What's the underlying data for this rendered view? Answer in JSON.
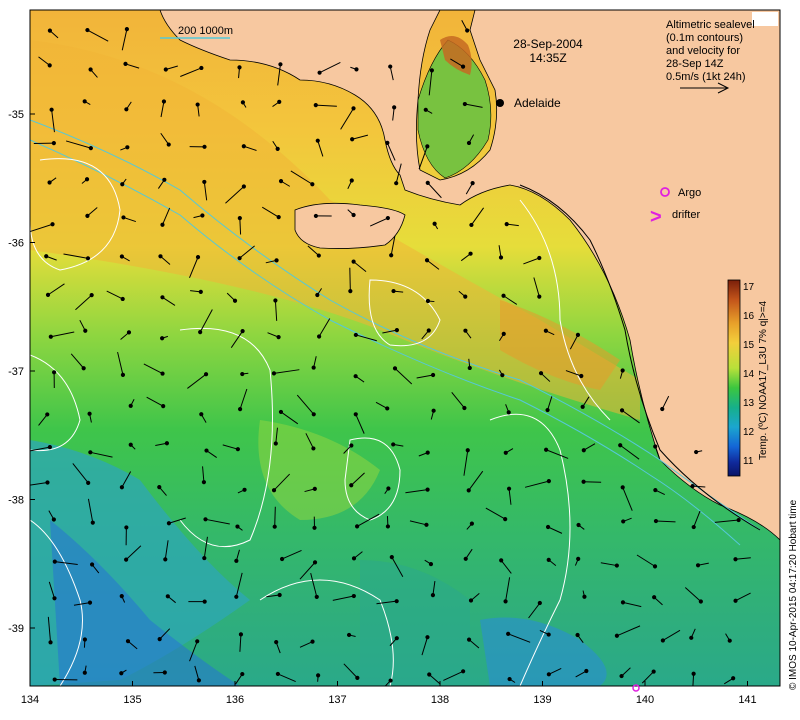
{
  "header": {
    "date": "28-Sep-2004",
    "time": "14:35Z"
  },
  "scale_bar": {
    "label": "200  1000m"
  },
  "sealevel_note": {
    "lines": [
      "Altimetric sealevel",
      "(0.1m contours)",
      "and velocity for",
      "28-Sep 14Z",
      "0.5m/s (1kt 24h)"
    ]
  },
  "places": {
    "city": "Adelaide"
  },
  "legend": {
    "argo": "Argo",
    "drifter": "drifter",
    "drifter_symbol": ">"
  },
  "colorbar": {
    "label": "Temp. (ºC) NOAA17_L3U 7% q|>=4",
    "ticks": [
      "17",
      "16",
      "15",
      "14",
      "13",
      "12",
      "11"
    ],
    "colors": [
      "#7a1f0a",
      "#c2541a",
      "#e8a02a",
      "#f3cf3b",
      "#b8e03a",
      "#3cc63f",
      "#16b08a",
      "#1ba6cf",
      "#1466d6",
      "#102a9c",
      "#0a1466"
    ]
  },
  "axes": {
    "x_ticks": [
      "134",
      "135",
      "136",
      "137",
      "138",
      "139",
      "140",
      "141"
    ],
    "y_ticks": [
      "-35",
      "-36",
      "-37",
      "-38",
      "-39"
    ]
  },
  "credit": "© IMOS 10-Apr-2015 04:17:20 Hobart time"
}
